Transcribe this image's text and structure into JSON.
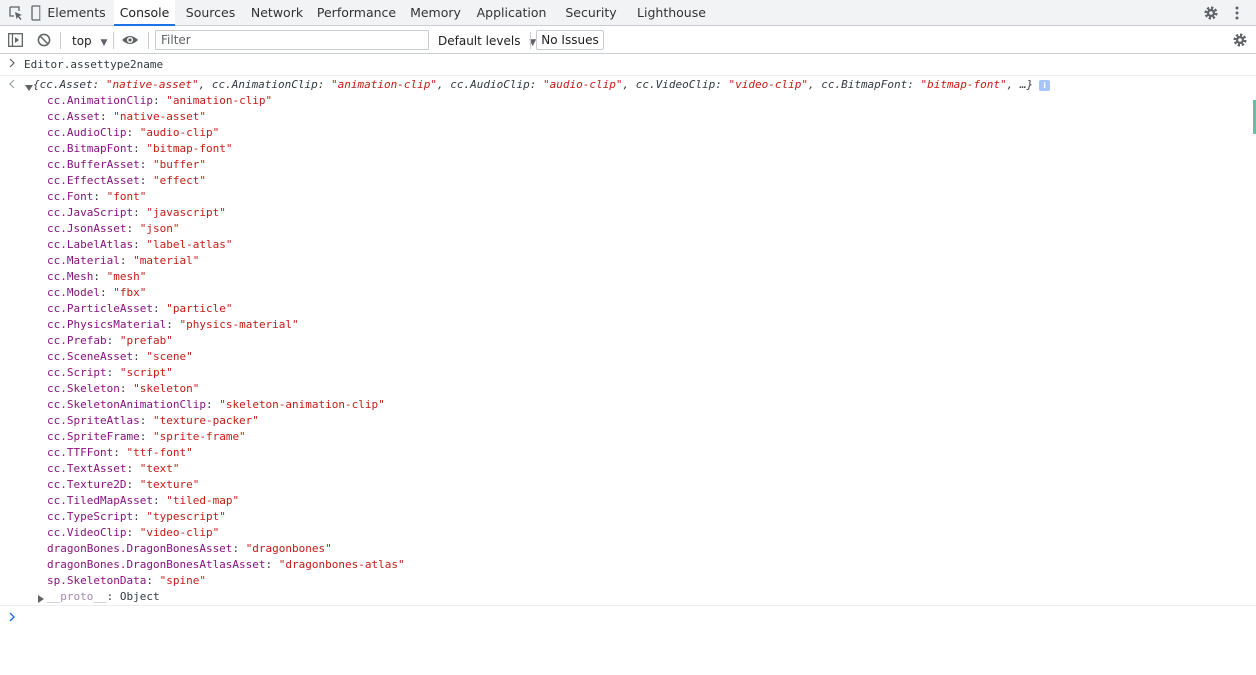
{
  "tabs": [
    {
      "label": "Elements",
      "selected": false
    },
    {
      "label": "Console",
      "selected": true
    },
    {
      "label": "Sources",
      "selected": false
    },
    {
      "label": "Network",
      "selected": false
    },
    {
      "label": "Performance",
      "selected": false
    },
    {
      "label": "Memory",
      "selected": false
    },
    {
      "label": "Application",
      "selected": false
    },
    {
      "label": "Security",
      "selected": false
    },
    {
      "label": "Lighthouse",
      "selected": false
    }
  ],
  "toolbar": {
    "context": "top",
    "filter_placeholder": "Filter",
    "levels": "Default levels",
    "issues": "No Issues"
  },
  "console": {
    "command": "Editor.assettype2name",
    "preview": [
      {
        "key": "cc.Asset",
        "value": "\"native-asset\""
      },
      {
        "key": "cc.AnimationClip",
        "value": "\"animation-clip\""
      },
      {
        "key": "cc.AudioClip",
        "value": "\"audio-clip\""
      },
      {
        "key": "cc.VideoClip",
        "value": "\"video-clip\""
      },
      {
        "key": "cc.BitmapFont",
        "value": "\"bitmap-font\""
      }
    ],
    "preview_ellipsis": "…",
    "info_badge": "i",
    "properties": [
      {
        "key": "cc.AnimationClip",
        "value": "\"animation-clip\""
      },
      {
        "key": "cc.Asset",
        "value": "\"native-asset\""
      },
      {
        "key": "cc.AudioClip",
        "value": "\"audio-clip\""
      },
      {
        "key": "cc.BitmapFont",
        "value": "\"bitmap-font\""
      },
      {
        "key": "cc.BufferAsset",
        "value": "\"buffer\""
      },
      {
        "key": "cc.EffectAsset",
        "value": "\"effect\""
      },
      {
        "key": "cc.Font",
        "value": "\"font\""
      },
      {
        "key": "cc.JavaScript",
        "value": "\"javascript\""
      },
      {
        "key": "cc.JsonAsset",
        "value": "\"json\""
      },
      {
        "key": "cc.LabelAtlas",
        "value": "\"label-atlas\""
      },
      {
        "key": "cc.Material",
        "value": "\"material\""
      },
      {
        "key": "cc.Mesh",
        "value": "\"mesh\""
      },
      {
        "key": "cc.Model",
        "value": "\"fbx\""
      },
      {
        "key": "cc.ParticleAsset",
        "value": "\"particle\""
      },
      {
        "key": "cc.PhysicsMaterial",
        "value": "\"physics-material\""
      },
      {
        "key": "cc.Prefab",
        "value": "\"prefab\""
      },
      {
        "key": "cc.SceneAsset",
        "value": "\"scene\""
      },
      {
        "key": "cc.Script",
        "value": "\"script\""
      },
      {
        "key": "cc.Skeleton",
        "value": "\"skeleton\""
      },
      {
        "key": "cc.SkeletonAnimationClip",
        "value": "\"skeleton-animation-clip\""
      },
      {
        "key": "cc.SpriteAtlas",
        "value": "\"texture-packer\""
      },
      {
        "key": "cc.SpriteFrame",
        "value": "\"sprite-frame\""
      },
      {
        "key": "cc.TTFFont",
        "value": "\"ttf-font\""
      },
      {
        "key": "cc.TextAsset",
        "value": "\"text\""
      },
      {
        "key": "cc.Texture2D",
        "value": "\"texture\""
      },
      {
        "key": "cc.TiledMapAsset",
        "value": "\"tiled-map\""
      },
      {
        "key": "cc.TypeScript",
        "value": "\"typescript\""
      },
      {
        "key": "cc.VideoClip",
        "value": "\"video-clip\""
      },
      {
        "key": "dragonBones.DragonBonesAsset",
        "value": "\"dragonbones\""
      },
      {
        "key": "dragonBones.DragonBonesAtlasAsset",
        "value": "\"dragonbones-atlas\""
      },
      {
        "key": "sp.SkeletonData",
        "value": "\"spine\""
      }
    ],
    "proto": {
      "key": "__proto__",
      "value": "Object"
    }
  },
  "colors": {
    "accent": "#1a73e8",
    "property_key": "#881280",
    "string_value": "#c41a16",
    "prompt_blue": "#1a73e8"
  }
}
